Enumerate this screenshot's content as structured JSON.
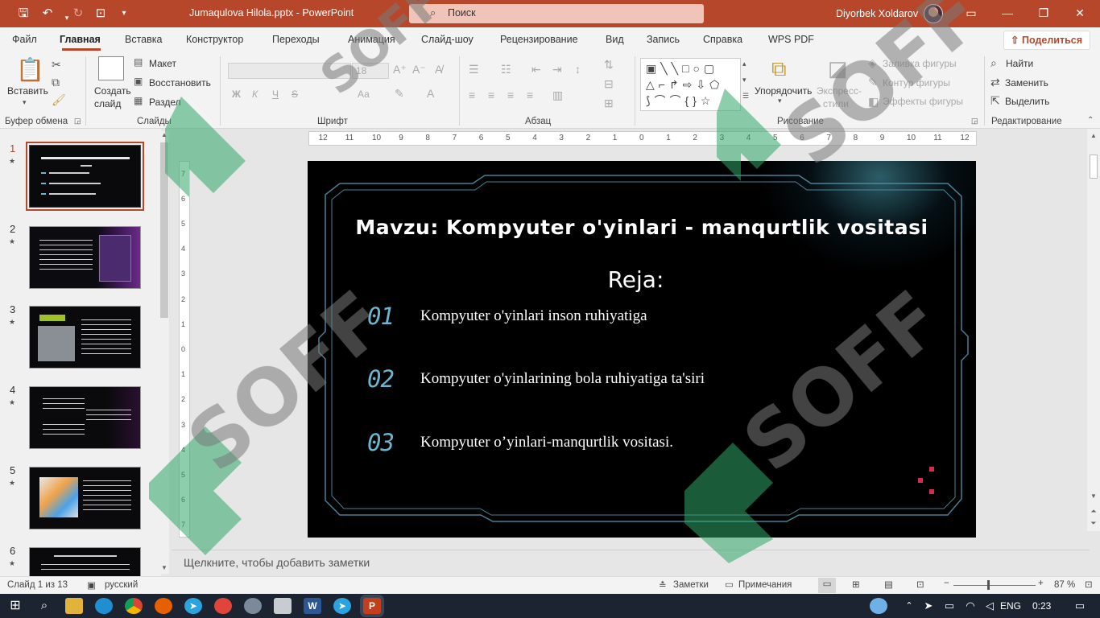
{
  "titlebar": {
    "doc_title": "Jumaqulova Hilola.pptx  -  PowerPoint",
    "search_placeholder": "Поиск",
    "user_name": "Diyorbek Xoldarov"
  },
  "tabs": {
    "items": [
      "Файл",
      "Главная",
      "Вставка",
      "Конструктор",
      "Переходы",
      "Анимация",
      "Слайд-шоу",
      "Рецензирование",
      "Вид",
      "Запись",
      "Справка",
      "WPS PDF"
    ],
    "active": "Главная",
    "share_label": "Поделиться"
  },
  "ribbon": {
    "clipboard": {
      "paste_label": "Вставить",
      "group_label": "Буфер обмена"
    },
    "slides": {
      "new_slide_line1": "Создать",
      "new_slide_line2": "слайд",
      "layout": "Макет",
      "reset": "Восстановить",
      "section": "Раздел",
      "group_label": "Слайды"
    },
    "font": {
      "size_value": "18",
      "group_label": "Шрифт",
      "bold": "Ж",
      "italic": "К",
      "underline": "Ч",
      "strike": "S",
      "case": "Аа"
    },
    "paragraph": {
      "group_label": "Абзац"
    },
    "drawing": {
      "arrange_line1": "Упорядочить",
      "quick_styles_line1": "Экспресс-",
      "quick_styles_line2": "стили",
      "fill": "Заливка фигуры",
      "outline": "Контур фигуры",
      "effects": "Эффекты фигуры",
      "group_label": "Рисование"
    },
    "editing": {
      "find": "Найти",
      "replace": "Заменить",
      "select": "Выделить",
      "group_label": "Редактирование"
    }
  },
  "ruler": {
    "h_ticks": [
      "12",
      "11",
      "10",
      "9",
      "8",
      "7",
      "6",
      "5",
      "4",
      "3",
      "2",
      "1",
      "0",
      "1",
      "2",
      "3",
      "4",
      "5",
      "6",
      "7",
      "8",
      "9",
      "10",
      "11",
      "12"
    ],
    "v_ticks": [
      "7",
      "6",
      "5",
      "4",
      "3",
      "2",
      "1",
      "0",
      "1",
      "2",
      "3",
      "4",
      "5",
      "6",
      "7"
    ]
  },
  "thumbnails": [
    {
      "num": "1",
      "active": true
    },
    {
      "num": "2",
      "active": false
    },
    {
      "num": "3",
      "active": false
    },
    {
      "num": "4",
      "active": false
    },
    {
      "num": "5",
      "active": false
    },
    {
      "num": "6",
      "active": false
    }
  ],
  "slide": {
    "title": "Mavzu: Kompyuter o'yinlari - manqurtlik vositasi",
    "subtitle": "Reja:",
    "items": [
      {
        "num": "01",
        "text": "Kompyuter o'yinlari inson ruhiyatiga"
      },
      {
        "num": "02",
        "text": "Kompyuter o'yinlarining bola ruhiyatiga ta'siri"
      },
      {
        "num": "03",
        "text": "Kompyuter o’yinlari-manqurtlik vositasi."
      }
    ]
  },
  "notes": {
    "placeholder": "Щелкните, чтобы добавить заметки"
  },
  "status": {
    "slide_info": "Слайд 1 из 13",
    "language": "русский",
    "notes_btn": "Заметки",
    "comments_btn": "Примечания",
    "zoom": "87 %"
  },
  "taskbar": {
    "lang": "ENG",
    "time": "0:23"
  },
  "watermark": {
    "text": "SOFF"
  },
  "colors": {
    "accent": "#b7472a",
    "slide_bg": "#000000",
    "frame": "#4f8fa6",
    "number": "#6cb6cf"
  }
}
